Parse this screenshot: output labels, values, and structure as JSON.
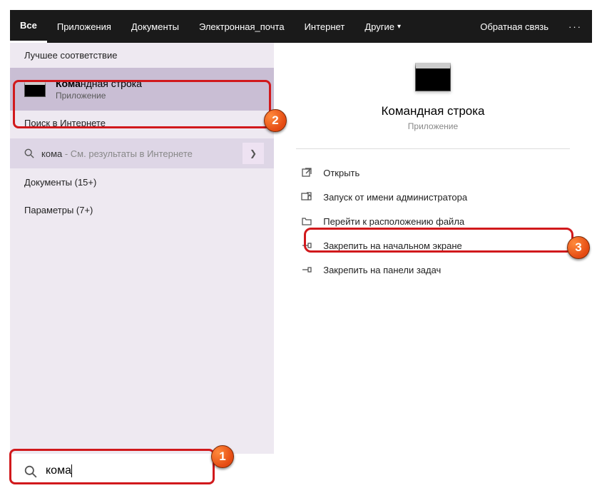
{
  "tabs": {
    "all": "Все",
    "apps": "Приложения",
    "docs": "Документы",
    "email": "Электронная_почта",
    "internet": "Интернет",
    "other": "Другие",
    "feedback": "Обратная связь"
  },
  "left": {
    "best_label": "Лучшее соответствие",
    "best_result": {
      "prefix": "Кома",
      "rest": "ндная строка",
      "sub": "Приложение"
    },
    "web_label": "Поиск в Интернете",
    "web_item": {
      "q": "кома",
      "suffix": " - См. результаты в Интернете"
    },
    "docs": "Документы (15+)",
    "params": "Параметры (7+)"
  },
  "right": {
    "title": "Командная строка",
    "kind": "Приложение",
    "actions": {
      "open": "Открыть",
      "admin": "Запуск от имени администратора",
      "location": "Перейти к расположению файла",
      "pin_start": "Закрепить на начальном экране",
      "pin_task": "Закрепить на панели задач"
    }
  },
  "search": {
    "value": "кома"
  },
  "badges": {
    "1": "1",
    "2": "2",
    "3": "3"
  }
}
